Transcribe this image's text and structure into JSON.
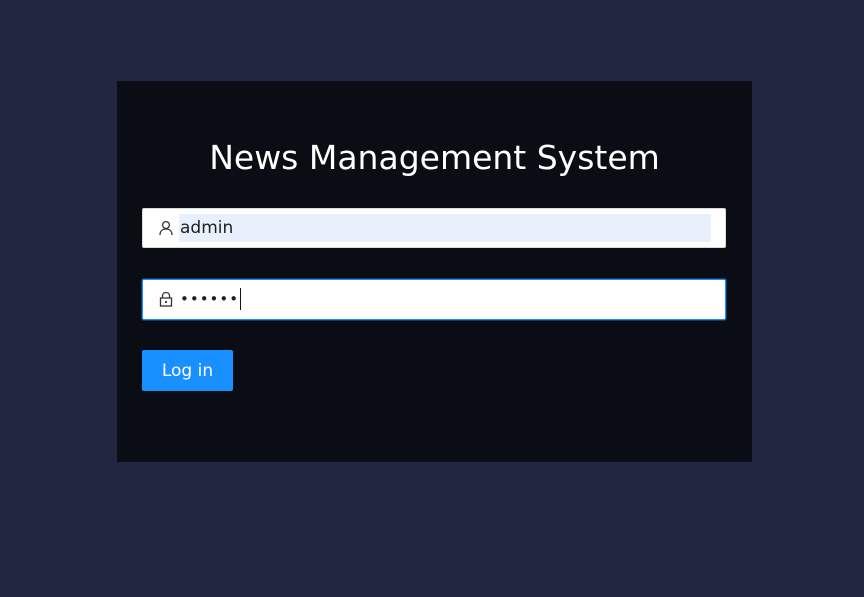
{
  "app": {
    "title": "News Management System"
  },
  "form": {
    "username": {
      "value": "admin",
      "icon": "user-icon",
      "autofilled": true
    },
    "password": {
      "masked_value": "••••••",
      "icon": "lock-icon",
      "focused": true
    },
    "submit_label": "Log in"
  },
  "colors": {
    "background": "#232641",
    "panel": "#0b0d15",
    "accent": "#1890ff",
    "autofill": "#e8f0fe"
  }
}
